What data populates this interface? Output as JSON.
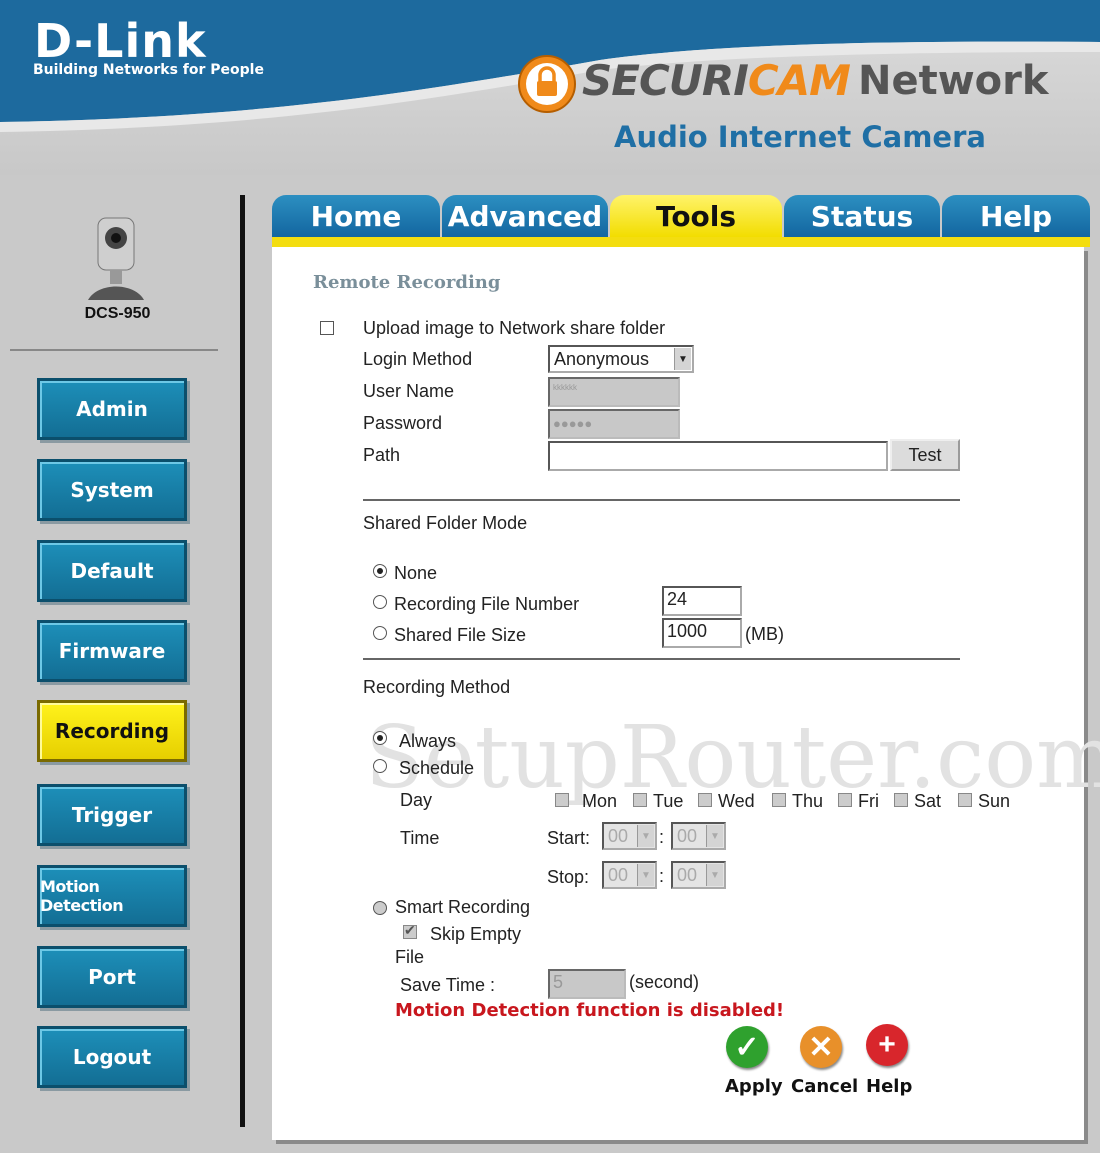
{
  "brand": {
    "logo": "D-Link",
    "tagline": "Building Networks for People",
    "product_prefix": "SECURI",
    "product_cam": "CAM",
    "product_suffix": "Network",
    "product_subtitle": "Audio Internet Camera"
  },
  "camera": {
    "model": "DCS-950"
  },
  "sidebar": {
    "items": [
      {
        "label": "Admin"
      },
      {
        "label": "System"
      },
      {
        "label": "Default"
      },
      {
        "label": "Firmware"
      },
      {
        "label": "Recording"
      },
      {
        "label": "Trigger"
      },
      {
        "label": "Motion Detection"
      },
      {
        "label": "Port"
      },
      {
        "label": "Logout"
      }
    ],
    "active": "Recording"
  },
  "tabs": [
    {
      "label": "Home"
    },
    {
      "label": "Advanced"
    },
    {
      "label": "Tools"
    },
    {
      "label": "Status"
    },
    {
      "label": "Help"
    }
  ],
  "active_tab": "Tools",
  "remote_recording": {
    "title": "Remote Recording",
    "upload_label": "Upload image to Network share folder",
    "login_method_label": "Login Method",
    "login_method_value": "Anonymous",
    "user_name_label": "User Name",
    "user_name_value": "kkkkkk",
    "password_label": "Password",
    "password_value": "●●●●●",
    "path_label": "Path",
    "path_value": "",
    "test_label": "Test"
  },
  "shared_folder": {
    "title": "Shared Folder Mode",
    "none_label": "None",
    "file_number_label": "Recording File Number",
    "file_number_value": "24",
    "file_size_label": "Shared File Size",
    "file_size_value": "1000",
    "file_size_unit": "(MB)"
  },
  "recording_method": {
    "title": "Recording Method",
    "always_label": "Always",
    "schedule_label": "Schedule",
    "day_label": "Day",
    "days": [
      "Mon",
      "Tue",
      "Wed",
      "Thu",
      "Fri",
      "Sat",
      "Sun"
    ],
    "time_label": "Time",
    "start_label": "Start:",
    "stop_label": "Stop:",
    "time_value": "00",
    "separator": ":",
    "smart_label": "Smart Recording",
    "skip_empty_label": "Skip Empty",
    "file_label": "File",
    "save_time_label": "Save Time :",
    "save_time_value": "5",
    "save_time_unit": "(second)",
    "warning": "Motion Detection function is disabled!"
  },
  "actions": {
    "apply": "Apply",
    "cancel": "Cancel",
    "help": "Help"
  },
  "watermark": "SetupRouter.com",
  "colors": {
    "header_blue": "#1f6fa5",
    "tab_blue": "#1f7fb3",
    "active_yellow": "#f3dd10",
    "warning_red": "#c8171e",
    "apply_green": "#2fa12e",
    "cancel_orange": "#e8902a",
    "help_red": "#d8262c"
  }
}
